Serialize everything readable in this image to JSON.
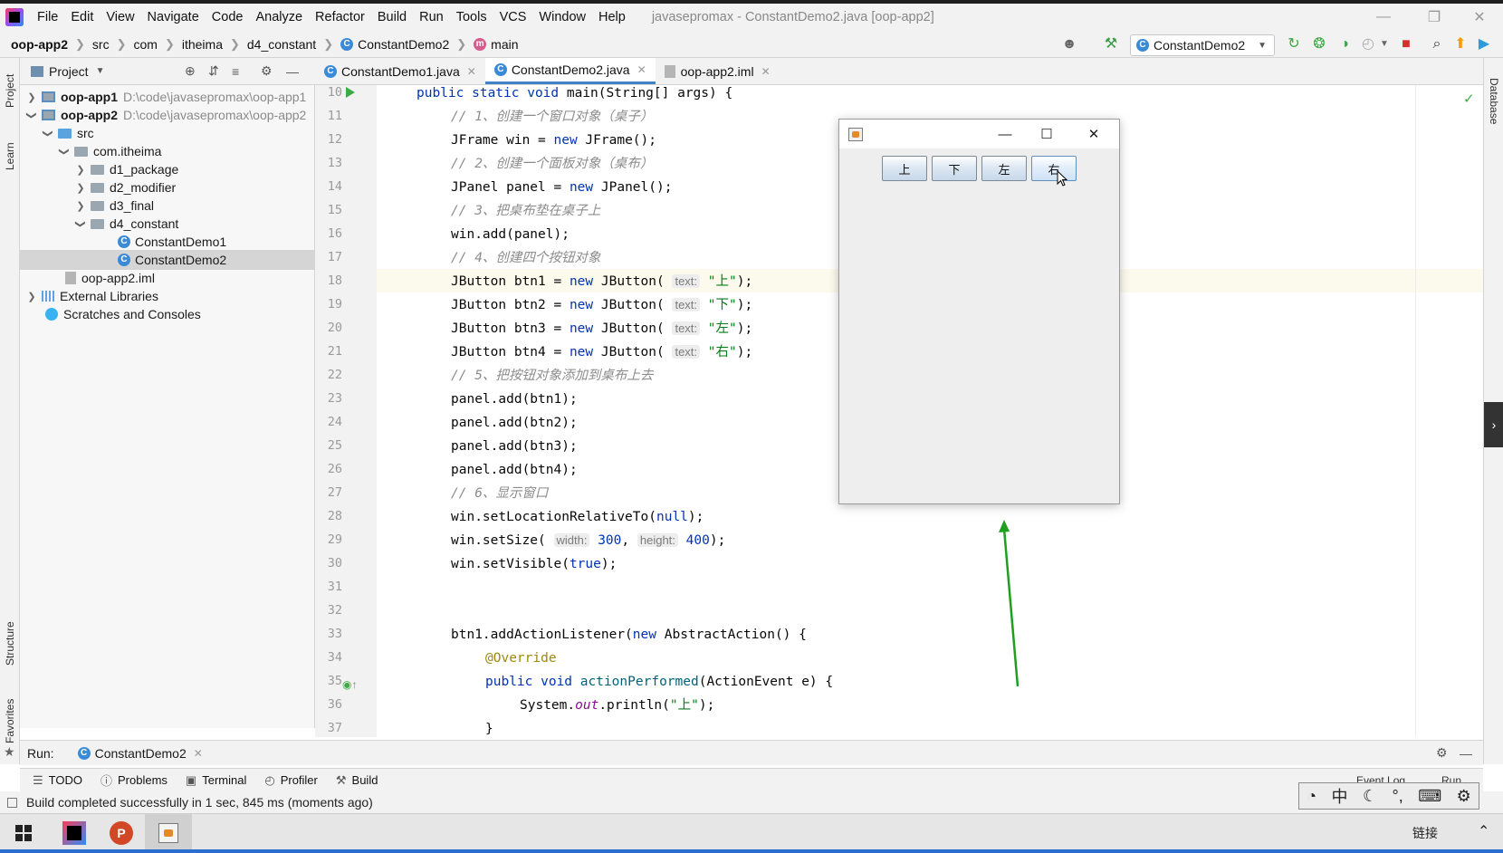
{
  "menubar": {
    "items": [
      "File",
      "Edit",
      "View",
      "Navigate",
      "Code",
      "Analyze",
      "Refactor",
      "Build",
      "Run",
      "Tools",
      "VCS",
      "Window",
      "Help"
    ],
    "window_title": "javasepromax - ConstantDemo2.java [oop-app2]"
  },
  "breadcrumb": {
    "items": [
      "oop-app2",
      "src",
      "com",
      "itheima",
      "d4_constant",
      "ConstantDemo2",
      "main"
    ]
  },
  "toolbar": {
    "run_config": "ConstantDemo2"
  },
  "project_panel": {
    "title": "Project",
    "tree": [
      {
        "label": "oop-app1",
        "path": "D:\\code\\javasepromax\\oop-app1"
      },
      {
        "label": "oop-app2",
        "path": "D:\\code\\javasepromax\\oop-app2"
      },
      {
        "label": "src"
      },
      {
        "label": "com.itheima"
      },
      {
        "label": "d1_package"
      },
      {
        "label": "d2_modifier"
      },
      {
        "label": "d3_final"
      },
      {
        "label": "d4_constant"
      },
      {
        "label": "ConstantDemo1"
      },
      {
        "label": "ConstantDemo2"
      },
      {
        "label": "oop-app2.iml"
      },
      {
        "label": "External Libraries"
      },
      {
        "label": "Scratches and Consoles"
      }
    ]
  },
  "left_strip": {
    "project": "Project",
    "learn": "Learn",
    "structure": "Structure",
    "favorites": "Favorites"
  },
  "right_strip": {
    "database": "Database"
  },
  "editor": {
    "tabs": [
      "ConstantDemo1.java",
      "ConstantDemo2.java",
      "oop-app2.iml"
    ],
    "line_numbers": [
      "10",
      "11",
      "12",
      "13",
      "14",
      "15",
      "16",
      "17",
      "18",
      "19",
      "20",
      "21",
      "22",
      "23",
      "24",
      "25",
      "26",
      "27",
      "28",
      "29",
      "30",
      "31",
      "32",
      "33",
      "34",
      "35",
      "36",
      "37"
    ],
    "code": {
      "l10": {
        "a": "public static void",
        "b": " main(String[] args) {"
      },
      "l11": "// 1、创建一个窗口对象（桌子）",
      "l12": {
        "a": "JFrame win = ",
        "b": "new",
        "c": " JFrame();"
      },
      "l13": "// 2、创建一个面板对象（桌布）",
      "l14": {
        "a": "JPanel panel = ",
        "b": "new",
        "c": " JPanel();"
      },
      "l15": "// 3、把桌布垫在桌子上",
      "l16": "win.add(panel);",
      "l17": "// 4、创建四个按钮对象",
      "l18": {
        "a": "JButton btn1 = ",
        "b": "new",
        "c": " JButton(",
        "hint": "text:",
        "s": "\"上\"",
        "d": ");"
      },
      "l19": {
        "a": "JButton btn2 = ",
        "b": "new",
        "c": " JButton(",
        "hint": "text:",
        "s": "\"下\"",
        "d": ");"
      },
      "l20": {
        "a": "JButton btn3 = ",
        "b": "new",
        "c": " JButton(",
        "hint": "text:",
        "s": "\"左\"",
        "d": ");"
      },
      "l21": {
        "a": "JButton btn4 = ",
        "b": "new",
        "c": " JButton(",
        "hint": "text:",
        "s": "\"右\"",
        "d": ");"
      },
      "l22": "// 5、把按钮对象添加到桌布上去",
      "l23": "panel.add(btn1);",
      "l24": "panel.add(btn2);",
      "l25": "panel.add(btn3);",
      "l26": "panel.add(btn4);",
      "l27": "// 6、显示窗口",
      "l28": {
        "a": "win.setLocationRelativeTo(",
        "b": "null",
        "c": ");"
      },
      "l29": {
        "a": "win.setSize(",
        "h1": "width:",
        "v1": "300",
        "sep": ", ",
        "h2": "height:",
        "v2": "400",
        "c": ");"
      },
      "l30": {
        "a": "win.setVisible(",
        "b": "true",
        "c": ");"
      },
      "l33": {
        "a": "btn1.addActionListener(",
        "b": "new",
        "c": " AbstractAction() {"
      },
      "l34": "@Override",
      "l35": {
        "a": "public void",
        "b": " ",
        "f": "actionPerformed",
        "c": "(ActionEvent e) {"
      },
      "l36": {
        "a": "System.",
        "f": "out",
        "b": ".println(",
        "s": "\"上\"",
        "c": ");"
      },
      "l37": "}"
    }
  },
  "jframe": {
    "buttons": [
      "上",
      "下",
      "左",
      "右"
    ]
  },
  "run_panel": {
    "label": "Run:",
    "config": "ConstantDemo2"
  },
  "bottom_tools": [
    "TODO",
    "Problems",
    "Terminal",
    "Profiler",
    "Build"
  ],
  "bottom_right": {
    "event_log": "Event Log",
    "run": "Run"
  },
  "status": {
    "message": "Build completed successfully in 1 sec, 845 ms (moments ago)"
  },
  "ime": {
    "mode": "中"
  },
  "taskbar": {
    "tray_text": "链接"
  },
  "colors": {
    "accent": "#4083c9",
    "run_green": "#3cab45",
    "arrow_green": "#1ea01e"
  }
}
